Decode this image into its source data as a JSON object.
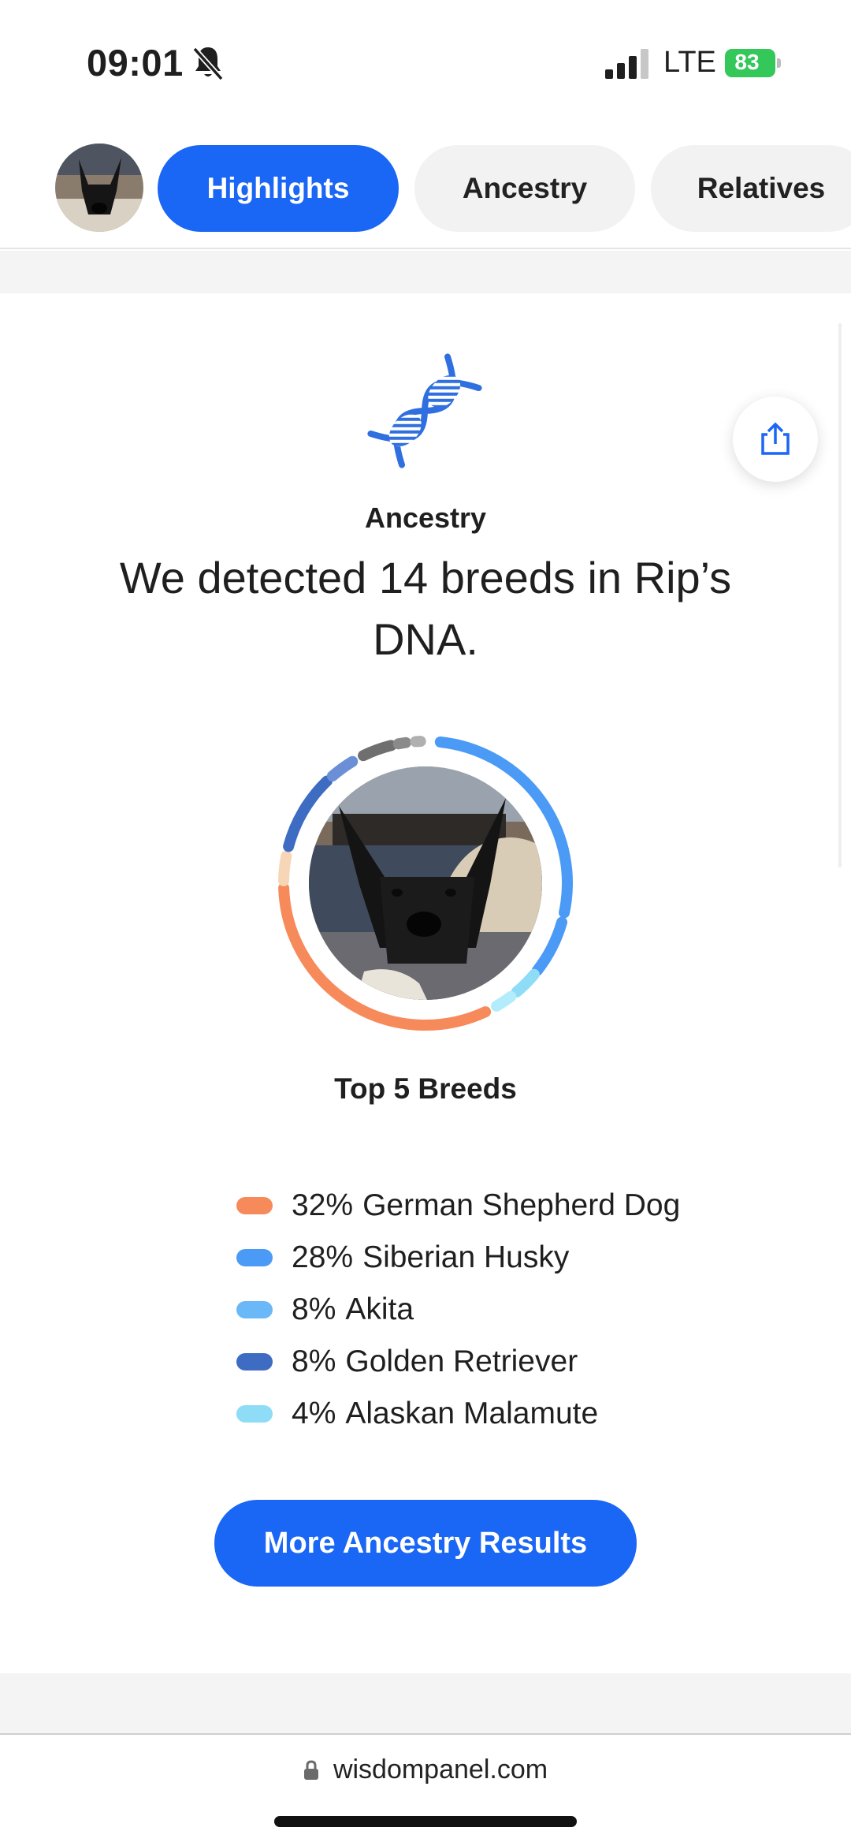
{
  "status_bar": {
    "time": "09:01",
    "network": "LTE",
    "battery": "83"
  },
  "tabs": [
    {
      "label": "Highlights",
      "active": true
    },
    {
      "label": "Ancestry",
      "active": false
    },
    {
      "label": "Relatives",
      "active": false
    }
  ],
  "card": {
    "section_label": "Ancestry",
    "headline": "We detected 14 breeds in Rip’s DNA.",
    "top_breeds_title": "Top 5 Breeds",
    "breeds": [
      {
        "percent": "32%",
        "name": "German Shepherd Dog",
        "color": "#f78a5b"
      },
      {
        "percent": "28%",
        "name": "Siberian Husky",
        "color": "#4b9af5"
      },
      {
        "percent": "8%",
        "name": "Akita",
        "color": "#6ab8f7"
      },
      {
        "percent": "8%",
        "name": "Golden Retriever",
        "color": "#3d6cc2"
      },
      {
        "percent": "4%",
        "name": "Alaskan Malamute",
        "color": "#8fdcf7"
      }
    ],
    "cta_label": "More Ancestry Results"
  },
  "browser": {
    "url": "wisdompanel.com"
  },
  "colors": {
    "accent": "#1a66f5",
    "battery": "#34c759"
  }
}
